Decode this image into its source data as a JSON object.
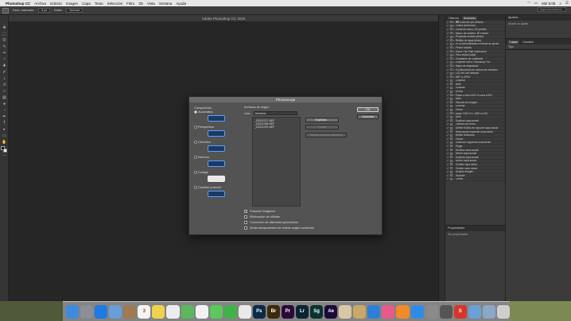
{
  "menubar": {
    "app": "Photoshop CC",
    "items": [
      "Archivo",
      "Edición",
      "Imagen",
      "Capa",
      "Texto",
      "Selección",
      "Filtro",
      "3D",
      "Vista",
      "Ventana",
      "Ayuda"
    ],
    "clock": "Mié 5:08"
  },
  "optbar": {
    "feather_label": "Desv. estimado:",
    "feather_value": "0 px",
    "style_label": "Estilo:",
    "style_value": "Normal"
  },
  "window_title": "Adobe Photoshop CC 2015",
  "actions_panel": {
    "tabs": [
      "Historia",
      "Acciones"
    ],
    "rows": [
      {
        "check": "✓",
        "arrow": "▾",
        "folder": true,
        "label": "Acciones por defecto"
      },
      {
        "check": "✓",
        "arrow": "▸",
        "folder": false,
        "label": "Viñeta (selección)"
      },
      {
        "check": "✓",
        "arrow": "▸",
        "folder": false,
        "label": "Canal de marco, 50 píxeles"
      },
      {
        "check": "✓",
        "arrow": "▸",
        "folder": false,
        "label": "Marco de madera, 50 píxeles"
      },
      {
        "check": "✓",
        "arrow": "▸",
        "folder": false,
        "label": "Proyectar sombra (texto)"
      },
      {
        "check": "✓",
        "arrow": "▸",
        "folder": false,
        "label": "Reflejo de agua (texto)"
      },
      {
        "check": "✓",
        "arrow": "▸",
        "folder": false,
        "label": "RGB personalizado a escala de grises"
      },
      {
        "check": "✓",
        "arrow": "▸",
        "folder": false,
        "label": "Plomo fundido"
      },
      {
        "check": "✓",
        "arrow": "▸",
        "folder": false,
        "label": "Hacer Clip Path (selección)"
      },
      {
        "check": "✓",
        "arrow": "▸",
        "folder": false,
        "label": "Tono sepia (capa)"
      },
      {
        "check": "✓",
        "arrow": "▸",
        "folder": false,
        "label": "Cuadrante de cuadrante"
      },
      {
        "check": "✓",
        "arrow": "▸",
        "folder": false,
        "label": "Exportar como Photoshop PDF"
      },
      {
        "check": "✓",
        "arrow": "▸",
        "folder": false,
        "label": "Mapa de degradado"
      },
      {
        "check": "✓",
        "arrow": "▾",
        "folder": false,
        "label": "Configuración de pintura de previsión"
      },
      {
        "check": "✓",
        "arrow": "▾",
        "folder": false,
        "label": "LUZ de Lab Veteado"
      },
      {
        "check": "✓",
        "arrow": "▾",
        "folder": false,
        "label": "NEF a JPEG"
      },
      {
        "check": "✓",
        "arrow": "",
        "folder": false,
        "label": "Exportar"
      },
      {
        "check": "✓",
        "arrow": "",
        "folder": false,
        "label": "Abrir"
      },
      {
        "check": "✓",
        "arrow": "",
        "folder": false,
        "label": "Guardar"
      },
      {
        "check": "✓",
        "arrow": "",
        "folder": false,
        "label": "Cerrar"
      },
      {
        "check": "✓",
        "arrow": "▾",
        "folder": false,
        "label": "Pasar a jpeg 1500 % para el BG"
      },
      {
        "check": "✓",
        "arrow": "",
        "folder": false,
        "label": "Abrir"
      },
      {
        "check": "✓",
        "arrow": "",
        "folder": false,
        "label": "Tamaño de imagen"
      },
      {
        "check": "✓",
        "arrow": "",
        "folder": false,
        "label": "Guardar"
      },
      {
        "check": "✓",
        "arrow": "",
        "folder": false,
        "label": "Cerrar"
      },
      {
        "check": "✓",
        "arrow": "▾",
        "folder": false,
        "label": "pasar 1920 % o 1800 px BG"
      },
      {
        "check": "✓",
        "arrow": "",
        "folder": false,
        "label": "Abrir"
      },
      {
        "check": "✓",
        "arrow": "",
        "folder": false,
        "label": "Duplicar capa actual"
      },
      {
        "check": "✓",
        "arrow": "",
        "folder": false,
        "label": "Tamaño de lienzo"
      },
      {
        "check": "✓",
        "arrow": "",
        "folder": false,
        "label": "Definir Estilos de capa de capa actual"
      },
      {
        "check": "✓",
        "arrow": "",
        "folder": false,
        "label": "Seleccionar siguiente documento"
      },
      {
        "check": "✓",
        "arrow": "",
        "folder": false,
        "label": "Definir Selección"
      },
      {
        "check": "✓",
        "arrow": "",
        "folder": false,
        "label": "Cerrar"
      },
      {
        "check": "✓",
        "arrow": "",
        "folder": false,
        "label": "Selección siguiente documento"
      },
      {
        "check": "✓",
        "arrow": "",
        "folder": false,
        "label": "Pegar"
      },
      {
        "check": "✓",
        "arrow": "",
        "folder": false,
        "label": "Duplicar capa actual"
      },
      {
        "check": "✓",
        "arrow": "",
        "folder": false,
        "label": "Mover capa actual"
      },
      {
        "check": "✓",
        "arrow": "",
        "folder": false,
        "label": "Duplicar capa actual"
      },
      {
        "check": "✓",
        "arrow": "",
        "folder": false,
        "label": "Mover capa actual"
      },
      {
        "check": "✓",
        "arrow": "",
        "folder": false,
        "label": "Ocultar capa actual"
      },
      {
        "check": "✓",
        "arrow": "",
        "folder": false,
        "label": "Ocultar capa actual"
      },
      {
        "check": "✓",
        "arrow": "",
        "folder": false,
        "label": "Acoplar imagen"
      },
      {
        "check": "✓",
        "arrow": "",
        "folder": false,
        "label": "Guardar"
      },
      {
        "check": "✓",
        "arrow": "",
        "folder": false,
        "label": "Cerrar"
      }
    ]
  },
  "properties_panel": {
    "title": "Propiedades",
    "empty": "Sin propiedades"
  },
  "right_panel": {
    "search_placeholder": "Aspectos básicos",
    "adjust_title": "Ajustes",
    "adjust_info": "Añadir un ajuste",
    "layers_tabs": [
      "Capas",
      "Canales"
    ],
    "layer_kind": "Tipo"
  },
  "dialog": {
    "title": "Photomerge",
    "layout_heading": "Composición",
    "layouts": [
      {
        "label": "Automático",
        "selected": true
      },
      {
        "label": "Perspectiva",
        "selected": false
      },
      {
        "label": "Cilíndrico",
        "selected": false
      },
      {
        "label": "Esférica",
        "selected": false
      },
      {
        "label": "Collage",
        "selected": false
      },
      {
        "label": "Cambiar posición",
        "selected": false
      }
    ],
    "source_heading": "Archivos de origen",
    "use_label": "Usar:",
    "use_value": "Archivos",
    "files": [
      "_DSC6707.NEF",
      "_DSC6708.NEF",
      "_DSC6709.NEF"
    ],
    "buttons": {
      "browse": "Explorar...",
      "remove": "Quitar",
      "add_open": "Añadir archivos abiertos",
      "ok": "OK",
      "cancel": "Cancelar"
    },
    "options": [
      {
        "label": "Fusionar imágenes",
        "checked": true
      },
      {
        "label": "Eliminación de viñetas",
        "checked": false
      },
      {
        "label": "Corrección de distorsión geométrica",
        "checked": false
      },
      {
        "label": "Áreas transparentes de relleno según contenido",
        "checked": false
      }
    ]
  },
  "dock": {
    "icons": [
      {
        "name": "finder",
        "color": "#3d8be0",
        "glyph": ""
      },
      {
        "name": "launchpad",
        "color": "#8a8f98",
        "glyph": ""
      },
      {
        "name": "safari",
        "color": "#1f7be3",
        "glyph": ""
      },
      {
        "name": "mail",
        "color": "#6a9ed8",
        "glyph": ""
      },
      {
        "name": "contacts",
        "color": "#a07a52",
        "glyph": ""
      },
      {
        "name": "calendar",
        "color": "#f4f4f4",
        "glyph": "3"
      },
      {
        "name": "notes",
        "color": "#f0d24c",
        "glyph": ""
      },
      {
        "name": "reminders",
        "color": "#ececec",
        "glyph": ""
      },
      {
        "name": "maps",
        "color": "#5cb85c",
        "glyph": ""
      },
      {
        "name": "photos",
        "color": "#f2f2f2",
        "glyph": ""
      },
      {
        "name": "messages",
        "color": "#5ac85a",
        "glyph": ""
      },
      {
        "name": "facetime",
        "color": "#3fb24a",
        "glyph": ""
      },
      {
        "name": "chrome",
        "color": "#e9e9e9",
        "glyph": ""
      },
      {
        "name": "photoshop",
        "color": "#0b2a4a",
        "glyph": "Ps"
      },
      {
        "name": "bridge",
        "color": "#3d2a0a",
        "glyph": "Br"
      },
      {
        "name": "premiere",
        "color": "#2a0a3a",
        "glyph": "Pr"
      },
      {
        "name": "lightroom",
        "color": "#0a2433",
        "glyph": "Lr"
      },
      {
        "name": "speedgrade",
        "color": "#0a3330",
        "glyph": "Sg"
      },
      {
        "name": "after-effects",
        "color": "#1a0a3a",
        "glyph": "Ae"
      },
      {
        "name": "illustration-app",
        "color": "#d8c8a8",
        "glyph": ""
      },
      {
        "name": "sketch-app",
        "color": "#c8a86a",
        "glyph": ""
      },
      {
        "name": "keynote",
        "color": "#2f7fd8",
        "glyph": ""
      },
      {
        "name": "itunes",
        "color": "#e85a8a",
        "glyph": ""
      },
      {
        "name": "ibooks",
        "color": "#f08a2a",
        "glyph": ""
      },
      {
        "name": "app-store",
        "color": "#2f8be8",
        "glyph": ""
      },
      {
        "name": "system-preferences",
        "color": "#8a8a8a",
        "glyph": ""
      },
      {
        "name": "utility-app",
        "color": "#555555",
        "glyph": ""
      },
      {
        "name": "scrivener",
        "color": "#d8352a",
        "glyph": "S"
      },
      {
        "name": "downloads",
        "color": "#6aa0d8",
        "glyph": ""
      },
      {
        "name": "documents",
        "color": "#8aa8c8",
        "glyph": ""
      },
      {
        "name": "trash",
        "color": "#cfcfcf",
        "glyph": ""
      }
    ]
  }
}
